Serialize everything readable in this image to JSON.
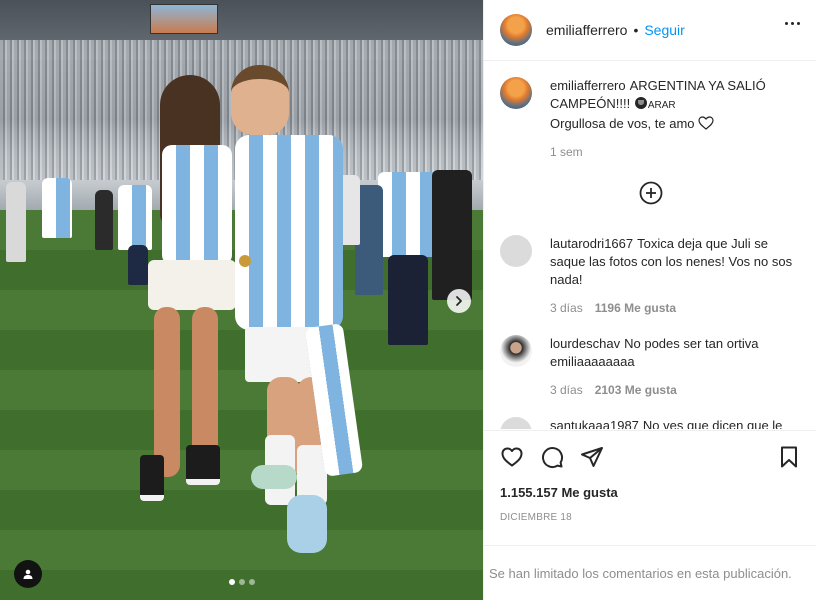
{
  "post": {
    "author": "emiliafferrero",
    "follow_label": "Seguir",
    "separator": "•",
    "caption": {
      "username": "emiliafferrero",
      "line1": "ARGENTINA YA SALIÓ CAMPEÓN!!!!",
      "emoji_text": "ARAR",
      "line2": "Orgullosa de vos, te amo",
      "time": "1 sem"
    },
    "carousel": {
      "total_slides": 3,
      "active_slide": 1
    }
  },
  "comments": [
    {
      "username": "lautarodri1667",
      "text": "Toxica deja que Juli se saque las fotos con los nenes! Vos no sos nada!",
      "time": "3 días",
      "likes": "1196 Me gusta"
    },
    {
      "username": "lourdeschav",
      "text": "No podes ser tan ortiva emiliaaaaaaaa",
      "time": "3 días",
      "likes": "2103 Me gusta"
    },
    {
      "username": "santukaaa1987",
      "text": "No ves que dicen que le sirde",
      "time": "",
      "likes": ""
    }
  ],
  "engagement": {
    "likes": "1.155.157 Me gusta",
    "date": "DICIEMBRE 18"
  },
  "footer": {
    "comments_limited": "Se han limitado los comentarios en esta publicación."
  },
  "icons": {
    "like": "heart-icon",
    "comment": "comment-icon",
    "share": "paper-plane-icon",
    "save": "bookmark-icon",
    "more": "more-options-icon",
    "load_more": "plus-circle-icon",
    "next": "chevron-right-icon",
    "tag": "user-tag-icon"
  },
  "colors": {
    "accent": "#0095f6",
    "text": "#262626",
    "muted": "#8e8e8e",
    "border": "#efefef"
  }
}
